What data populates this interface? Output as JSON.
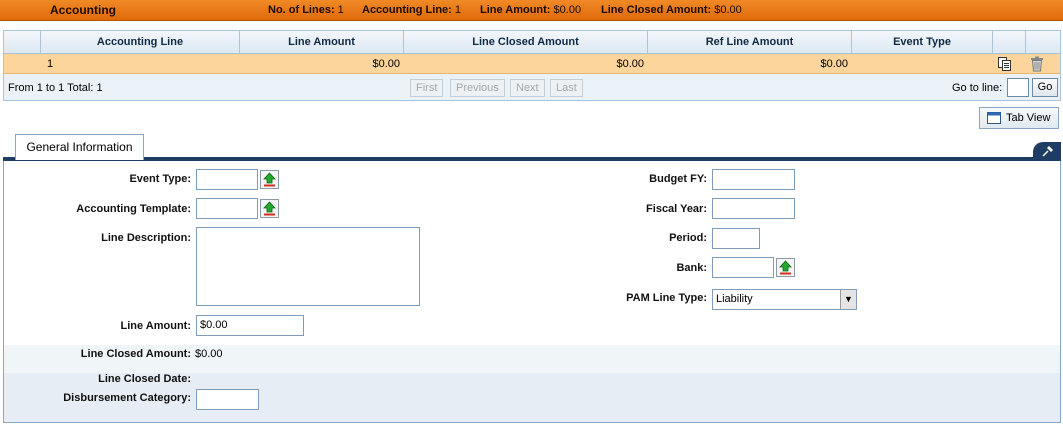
{
  "header": {
    "title": "Accounting",
    "no_lines_label": "No. of Lines:",
    "no_lines_value": "1",
    "acct_line_label": "Accounting Line:",
    "acct_line_value": "1",
    "line_amount_label": "Line Amount:",
    "line_amount_value": "$0.00",
    "line_closed_label": "Line Closed Amount:",
    "line_closed_value": "$0.00"
  },
  "grid": {
    "columns": [
      "Accounting Line",
      "Line Amount",
      "Line Closed Amount",
      "Ref Line Amount",
      "Event Type"
    ],
    "rows": [
      {
        "accounting_line": "1",
        "line_amount": "$0.00",
        "line_closed_amount": "$0.00",
        "ref_line_amount": "$0.00",
        "event_type": ""
      }
    ],
    "footer_text": "From 1 to 1 Total: 1",
    "pager": {
      "first": "First",
      "previous": "Previous",
      "next": "Next",
      "last": "Last"
    },
    "goto_label": "Go to line:",
    "goto_value": "",
    "go_button": "Go",
    "icons": {
      "copy": "copy-icon",
      "delete": "trash-icon"
    }
  },
  "tab_view_label": "Tab View",
  "tab_label": "General Information",
  "form": {
    "event_type_label": "Event Type:",
    "event_type_value": "",
    "accounting_template_label": "Accounting Template:",
    "accounting_template_value": "",
    "line_description_label": "Line Description:",
    "line_description_value": "",
    "line_amount_label": "Line Amount:",
    "line_amount_value": "$0.00",
    "line_closed_amount_label": "Line Closed Amount:",
    "line_closed_amount_value": "$0.00",
    "line_closed_date_label": "Line Closed Date:",
    "line_closed_date_value": "",
    "disbursement_category_label": "Disbursement Category:",
    "disbursement_category_value": "",
    "budget_fy_label": "Budget FY:",
    "budget_fy_value": "",
    "fiscal_year_label": "Fiscal Year:",
    "fiscal_year_value": "",
    "period_label": "Period:",
    "period_value": "",
    "bank_label": "Bank:",
    "bank_value": "",
    "pam_line_type_label": "PAM Line Type:",
    "pam_line_type_value": "Liability"
  },
  "colors": {
    "header_orange": "#e8771a",
    "selected_row": "#fbd59c",
    "navy": "#1f3d63",
    "lookup_green": "#22a82e",
    "lookup_red": "#d03020"
  }
}
